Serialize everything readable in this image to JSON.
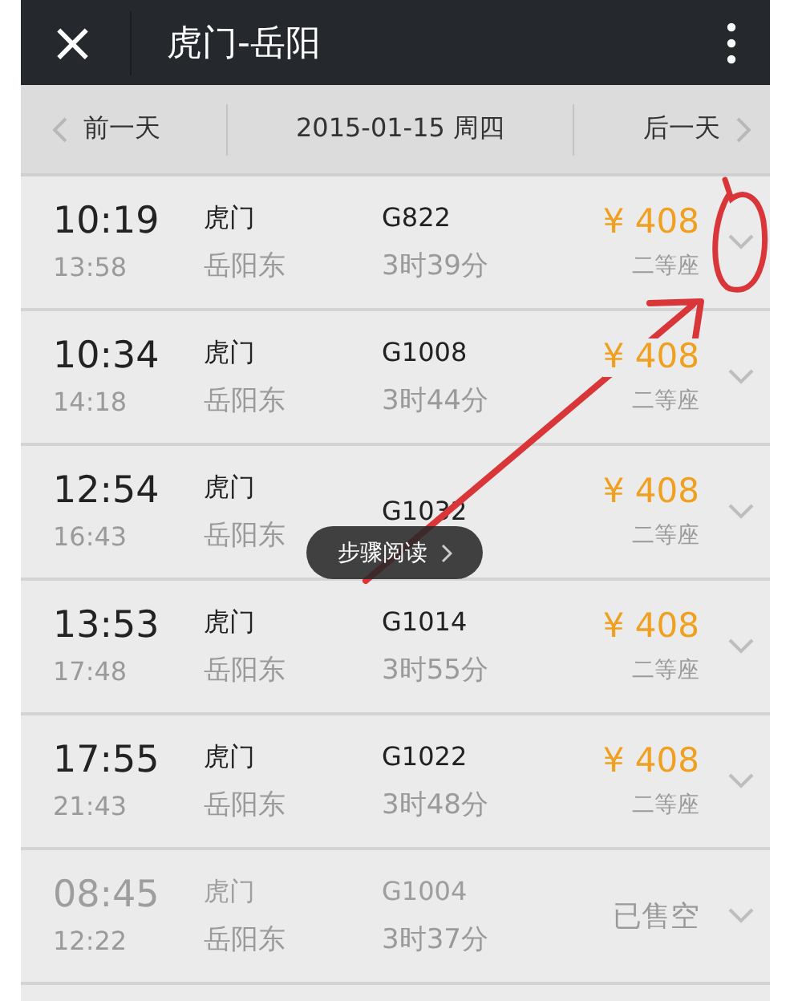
{
  "header": {
    "close_icon": "×",
    "title": "虎门-岳阳"
  },
  "date_bar": {
    "prev": "前一天",
    "date": "2015-01-15 周四",
    "next": "后一天"
  },
  "trains": [
    {
      "depart": "10:19",
      "arrive": "13:58",
      "from": "虎门",
      "to": "岳阳东",
      "train": "G822",
      "duration": "3时39分",
      "price": "¥ 408",
      "seat": "二等座",
      "sold_out": false
    },
    {
      "depart": "10:34",
      "arrive": "14:18",
      "from": "虎门",
      "to": "岳阳东",
      "train": "G1008",
      "duration": "3时44分",
      "price": "¥ 408",
      "seat": "二等座",
      "sold_out": false
    },
    {
      "depart": "12:54",
      "arrive": "16:43",
      "from": "虎门",
      "to": "岳阳东",
      "train": "G1032",
      "price": "¥ 408",
      "seat": "二等座",
      "sold_out": false
    },
    {
      "depart": "13:53",
      "arrive": "17:48",
      "from": "虎门",
      "to": "岳阳东",
      "train": "G1014",
      "duration": "3时55分",
      "price": "¥ 408",
      "seat": "二等座",
      "sold_out": false
    },
    {
      "depart": "17:55",
      "arrive": "21:43",
      "from": "虎门",
      "to": "岳阳东",
      "train": "G1022",
      "duration": "3时48分",
      "price": "¥ 408",
      "seat": "二等座",
      "sold_out": false
    },
    {
      "depart": "08:45",
      "arrive": "12:22",
      "from": "虎门",
      "to": "岳阳东",
      "train": "G1004",
      "duration": "3时37分",
      "status": "已售空",
      "sold_out": true
    }
  ],
  "step_reading_button": {
    "label": "步骤阅读"
  },
  "annotation": {
    "kind": "arrow_and_circle"
  }
}
